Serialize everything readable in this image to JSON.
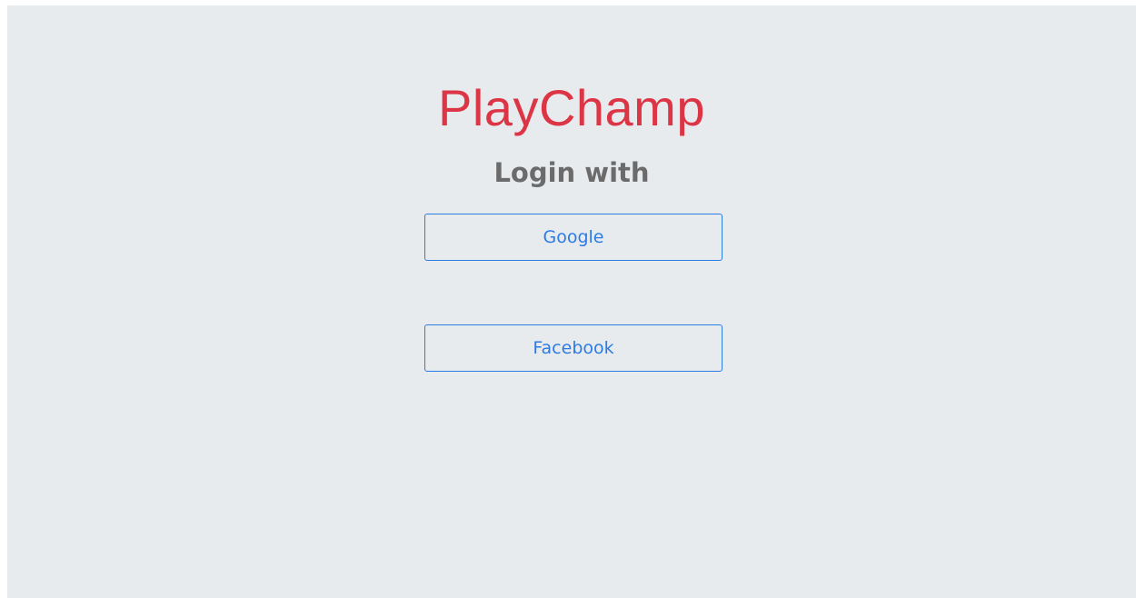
{
  "brand": {
    "name": "PlayChamp",
    "color": "#dc3545"
  },
  "login": {
    "heading": "Login with",
    "accent_color": "#2c7be5",
    "providers": [
      {
        "label": "Google"
      },
      {
        "label": "Facebook"
      }
    ]
  },
  "colors": {
    "background": "#e8ebee",
    "heading": "#6b6b6b"
  }
}
